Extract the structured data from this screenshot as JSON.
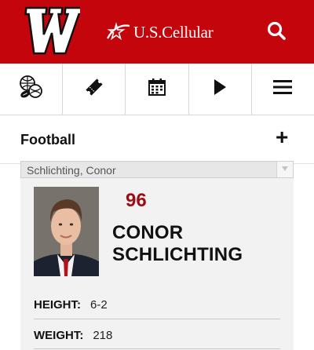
{
  "header": {
    "sponsor_text": "U.S.Cellular",
    "brand_color": "#c5050c",
    "logo_icon": "motion-w-logo-icon",
    "search_icon": "search-icon"
  },
  "nav_icons": [
    {
      "name": "sports-balls-icon"
    },
    {
      "name": "ticket-icon"
    },
    {
      "name": "calendar-icon"
    },
    {
      "name": "play-icon"
    },
    {
      "name": "hamburger-menu-icon"
    }
  ],
  "sport": {
    "title": "Football",
    "expand_symbol": "+"
  },
  "roster_select": {
    "selected": "Schlichting, Conor"
  },
  "player": {
    "number": "96",
    "first_name": "CONOR",
    "last_name": "SCHLICHTING",
    "stats": [
      {
        "label": "HEIGHT:",
        "value": "6-2"
      },
      {
        "label": "WEIGHT:",
        "value": "218"
      }
    ],
    "number_color": "#9b0d14"
  }
}
